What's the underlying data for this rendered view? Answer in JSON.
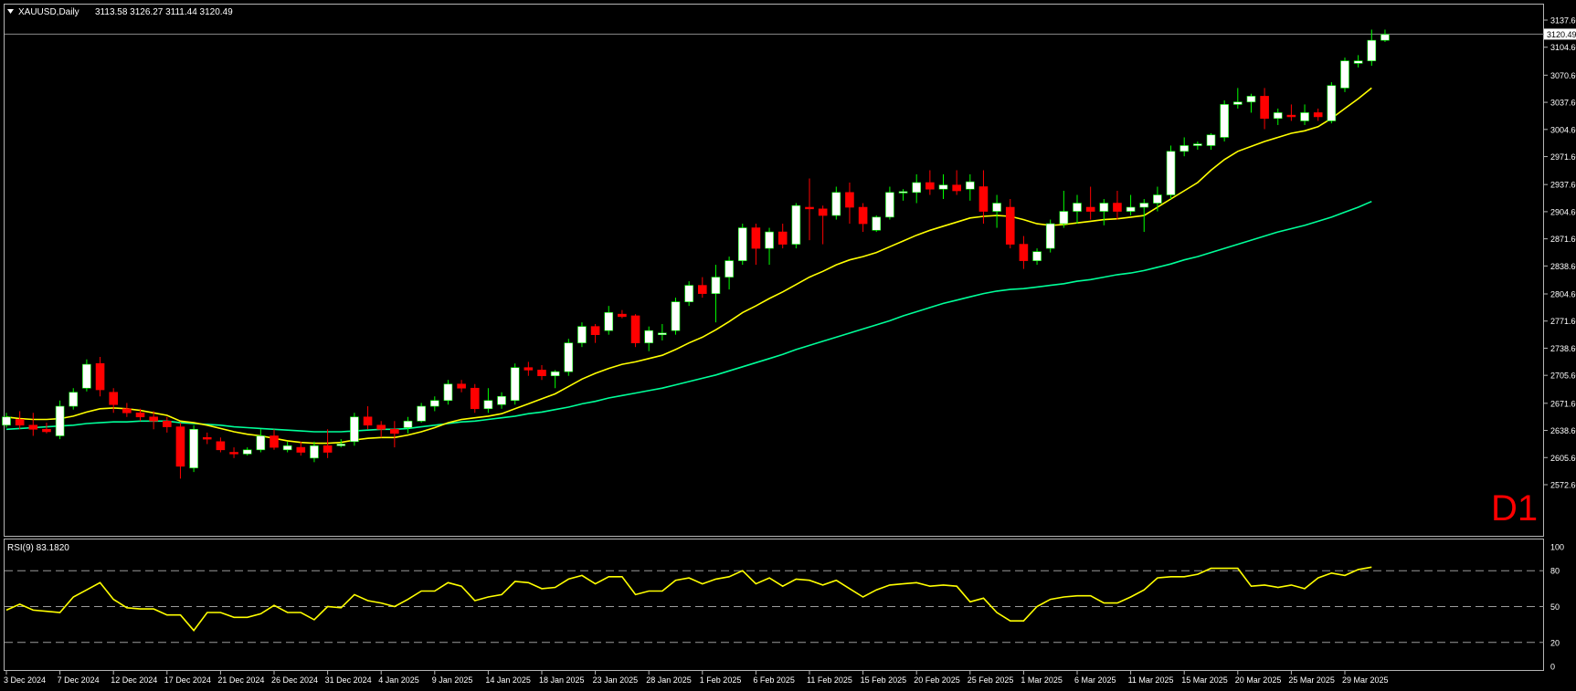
{
  "header": {
    "symbol": "XAUUSD,Daily",
    "ohlc": "3113.58 3126.27 3111.44 3120.49"
  },
  "watermark": "D1",
  "colors": {
    "background": "#000000",
    "bull_fill": "#ffffff",
    "bear_fill": "#ff0000",
    "wick_up": "#00ff00",
    "wick_down": "#ff0000",
    "ma_fast": "#ffff00",
    "ma_slow": "#00ff99",
    "rsi": "#ffff00",
    "grid_text": "#ffffff",
    "bid_line": "#8a8a8a"
  },
  "chart_data": [
    {
      "type": "candlestick",
      "title": "XAUUSD,Daily",
      "price_ticks": [
        "3137.60",
        "3104.60",
        "3070.60",
        "3037.60",
        "3004.60",
        "2971.60",
        "2937.60",
        "2904.60",
        "2871.60",
        "2838.60",
        "2804.60",
        "2771.60",
        "2738.60",
        "2705.60",
        "2671.60",
        "2638.60",
        "2605.60",
        "2572.60"
      ],
      "ylim": [
        2572.6,
        3137.6
      ],
      "current_price_label": "3120.49",
      "current_price": 3120.49,
      "date_labels": [
        "3 Dec 2024",
        "7 Dec 2024",
        "12 Dec 2024",
        "17 Dec 2024",
        "21 Dec 2024",
        "26 Dec 2024",
        "31 Dec 2024",
        "4 Jan 2025",
        "9 Jan 2025",
        "14 Jan 2025",
        "18 Jan 2025",
        "23 Jan 2025",
        "28 Jan 2025",
        "1 Feb 2025",
        "6 Feb 2025",
        "11 Feb 2025",
        "15 Feb 2025",
        "20 Feb 2025",
        "25 Feb 2025",
        "1 Mar 2025",
        "6 Mar 2025",
        "11 Mar 2025",
        "15 Mar 2025",
        "20 Mar 2025",
        "25 Mar 2025",
        "29 Mar 2025"
      ],
      "date_label_bar_index": [
        0,
        4,
        8,
        12,
        16,
        20,
        24,
        28,
        32,
        36,
        40,
        44,
        48,
        52,
        56,
        60,
        64,
        68,
        72,
        76,
        80,
        84,
        88,
        92,
        96,
        100
      ],
      "candles": [
        [
          2645,
          2660,
          2642,
          2655
        ],
        [
          2652,
          2662,
          2640,
          2645
        ],
        [
          2645,
          2660,
          2632,
          2640
        ],
        [
          2640,
          2648,
          2635,
          2637
        ],
        [
          2632,
          2675,
          2628,
          2668
        ],
        [
          2668,
          2690,
          2664,
          2685
        ],
        [
          2690,
          2725,
          2686,
          2719
        ],
        [
          2720,
          2728,
          2680,
          2688
        ],
        [
          2685,
          2690,
          2660,
          2670
        ],
        [
          2665,
          2672,
          2655,
          2660
        ],
        [
          2660,
          2665,
          2650,
          2655
        ],
        [
          2655,
          2662,
          2640,
          2650
        ],
        [
          2650,
          2655,
          2636,
          2643
        ],
        [
          2643,
          2648,
          2580,
          2595
        ],
        [
          2593,
          2645,
          2588,
          2640
        ],
        [
          2630,
          2636,
          2622,
          2628
        ],
        [
          2625,
          2630,
          2612,
          2615
        ],
        [
          2612,
          2618,
          2605,
          2610
        ],
        [
          2610,
          2618,
          2608,
          2615
        ],
        [
          2615,
          2640,
          2612,
          2632
        ],
        [
          2632,
          2640,
          2615,
          2618
        ],
        [
          2615,
          2625,
          2612,
          2620
        ],
        [
          2618,
          2625,
          2608,
          2612
        ],
        [
          2605,
          2625,
          2600,
          2620
        ],
        [
          2620,
          2640,
          2605,
          2612
        ],
        [
          2620,
          2628,
          2618,
          2622
        ],
        [
          2625,
          2660,
          2620,
          2655
        ],
        [
          2655,
          2668,
          2640,
          2645
        ],
        [
          2645,
          2650,
          2630,
          2640
        ],
        [
          2640,
          2650,
          2618,
          2635
        ],
        [
          2642,
          2655,
          2635,
          2650
        ],
        [
          2650,
          2672,
          2648,
          2668
        ],
        [
          2668,
          2680,
          2662,
          2675
        ],
        [
          2675,
          2700,
          2670,
          2695
        ],
        [
          2695,
          2700,
          2685,
          2690
        ],
        [
          2690,
          2695,
          2660,
          2665
        ],
        [
          2665,
          2690,
          2660,
          2675
        ],
        [
          2670,
          2685,
          2665,
          2680
        ],
        [
          2675,
          2720,
          2670,
          2715
        ],
        [
          2715,
          2722,
          2705,
          2712
        ],
        [
          2712,
          2718,
          2700,
          2705
        ],
        [
          2705,
          2712,
          2690,
          2710
        ],
        [
          2710,
          2750,
          2705,
          2745
        ],
        [
          2745,
          2770,
          2740,
          2765
        ],
        [
          2765,
          2768,
          2745,
          2755
        ],
        [
          2760,
          2790,
          2755,
          2782
        ],
        [
          2780,
          2785,
          2775,
          2777
        ],
        [
          2778,
          2780,
          2740,
          2745
        ],
        [
          2745,
          2765,
          2735,
          2760
        ],
        [
          2755,
          2768,
          2748,
          2757
        ],
        [
          2760,
          2800,
          2755,
          2795
        ],
        [
          2795,
          2820,
          2790,
          2815
        ],
        [
          2815,
          2825,
          2800,
          2805
        ],
        [
          2805,
          2840,
          2770,
          2825
        ],
        [
          2825,
          2850,
          2810,
          2845
        ],
        [
          2845,
          2890,
          2840,
          2885
        ],
        [
          2885,
          2890,
          2840,
          2860
        ],
        [
          2860,
          2885,
          2840,
          2880
        ],
        [
          2880,
          2890,
          2860,
          2865
        ],
        [
          2865,
          2915,
          2860,
          2912
        ],
        [
          2910,
          2945,
          2870,
          2908
        ],
        [
          2908,
          2912,
          2865,
          2900
        ],
        [
          2900,
          2935,
          2895,
          2928
        ],
        [
          2928,
          2940,
          2890,
          2910
        ],
        [
          2910,
          2915,
          2880,
          2890
        ],
        [
          2882,
          2900,
          2880,
          2898
        ],
        [
          2898,
          2935,
          2895,
          2928
        ],
        [
          2928,
          2932,
          2918,
          2929
        ],
        [
          2928,
          2950,
          2915,
          2940
        ],
        [
          2940,
          2955,
          2925,
          2932
        ],
        [
          2932,
          2950,
          2920,
          2937
        ],
        [
          2937,
          2955,
          2925,
          2930
        ],
        [
          2932,
          2950,
          2918,
          2941
        ],
        [
          2935,
          2955,
          2890,
          2905
        ],
        [
          2905,
          2925,
          2885,
          2915
        ],
        [
          2910,
          2920,
          2860,
          2865
        ],
        [
          2865,
          2875,
          2835,
          2845
        ],
        [
          2845,
          2860,
          2840,
          2856
        ],
        [
          2860,
          2895,
          2855,
          2890
        ],
        [
          2890,
          2930,
          2885,
          2905
        ],
        [
          2905,
          2925,
          2890,
          2915
        ],
        [
          2910,
          2935,
          2895,
          2905
        ],
        [
          2905,
          2920,
          2888,
          2915
        ],
        [
          2915,
          2930,
          2895,
          2905
        ],
        [
          2905,
          2925,
          2900,
          2910
        ],
        [
          2910,
          2920,
          2880,
          2915
        ],
        [
          2915,
          2935,
          2905,
          2925
        ],
        [
          2925,
          2985,
          2920,
          2978
        ],
        [
          2978,
          2995,
          2972,
          2985
        ],
        [
          2985,
          2990,
          2980,
          2987
        ],
        [
          2985,
          3000,
          2980,
          2998
        ],
        [
          2995,
          3040,
          2990,
          3035
        ],
        [
          3035,
          3055,
          3030,
          3038
        ],
        [
          3038,
          3048,
          3025,
          3045
        ],
        [
          3045,
          3055,
          3005,
          3018
        ],
        [
          3018,
          3030,
          3010,
          3025
        ],
        [
          3022,
          3035,
          3015,
          3020
        ],
        [
          3015,
          3035,
          3010,
          3025
        ],
        [
          3025,
          3030,
          3015,
          3020
        ],
        [
          3015,
          3062,
          3012,
          3058
        ],
        [
          3055,
          3092,
          3050,
          3088
        ],
        [
          3085,
          3095,
          3080,
          3088
        ],
        [
          3088,
          3126,
          3082,
          3113
        ],
        [
          3113,
          3126,
          3111,
          3120
        ]
      ],
      "ma_fast": [
        2655,
        2653,
        2652,
        2652,
        2653,
        2656,
        2661,
        2665,
        2666,
        2665,
        2663,
        2660,
        2657,
        2650,
        2648,
        2645,
        2641,
        2637,
        2634,
        2632,
        2629,
        2626,
        2624,
        2623,
        2623,
        2624,
        2627,
        2629,
        2630,
        2630,
        2633,
        2637,
        2642,
        2648,
        2652,
        2654,
        2656,
        2659,
        2665,
        2671,
        2677,
        2683,
        2692,
        2701,
        2708,
        2714,
        2719,
        2722,
        2726,
        2730,
        2737,
        2745,
        2752,
        2761,
        2771,
        2782,
        2790,
        2799,
        2807,
        2816,
        2825,
        2832,
        2840,
        2846,
        2850,
        2855,
        2862,
        2869,
        2876,
        2882,
        2887,
        2892,
        2897,
        2899,
        2900,
        2899,
        2895,
        2890,
        2888,
        2889,
        2891,
        2893,
        2895,
        2896,
        2898,
        2900,
        2910,
        2920,
        2930,
        2940,
        2955,
        2968,
        2978,
        2984,
        2990,
        2995,
        3000,
        3003,
        3008,
        3018,
        3030,
        3042,
        3055
      ],
      "ma_slow": [
        2640,
        2641,
        2642,
        2643,
        2644,
        2645,
        2647,
        2648,
        2649,
        2649,
        2650,
        2650,
        2650,
        2648,
        2647,
        2646,
        2645,
        2643,
        2642,
        2641,
        2640,
        2639,
        2638,
        2637,
        2637,
        2637,
        2638,
        2639,
        2640,
        2640,
        2641,
        2643,
        2645,
        2647,
        2649,
        2650,
        2652,
        2654,
        2656,
        2659,
        2661,
        2664,
        2667,
        2671,
        2674,
        2678,
        2681,
        2684,
        2687,
        2690,
        2694,
        2698,
        2702,
        2706,
        2711,
        2716,
        2721,
        2726,
        2731,
        2737,
        2742,
        2747,
        2752,
        2757,
        2762,
        2767,
        2772,
        2778,
        2783,
        2788,
        2793,
        2797,
        2801,
        2805,
        2808,
        2810,
        2811,
        2813,
        2815,
        2817,
        2820,
        2822,
        2825,
        2828,
        2830,
        2833,
        2837,
        2841,
        2846,
        2850,
        2855,
        2860,
        2865,
        2870,
        2875,
        2880,
        2884,
        2888,
        2893,
        2898,
        2904,
        2910,
        2917
      ]
    },
    {
      "type": "line",
      "title": "RSI(9) 83.1820",
      "ticks": [
        "100",
        "80",
        "50",
        "20",
        "0"
      ],
      "levels": [
        80,
        50,
        20
      ],
      "ylim": [
        0,
        100
      ],
      "values": [
        47,
        52,
        47,
        46,
        45,
        58,
        64,
        70,
        56,
        49,
        48,
        48,
        43,
        43,
        30,
        45,
        45,
        41,
        41,
        44,
        51,
        45,
        45,
        39,
        50,
        49,
        60,
        55,
        53,
        50,
        56,
        63,
        63,
        70,
        67,
        55,
        58,
        60,
        71,
        70,
        65,
        66,
        73,
        76,
        69,
        75,
        75,
        60,
        63,
        63,
        72,
        74,
        69,
        73,
        75,
        80,
        69,
        74,
        67,
        73,
        72,
        68,
        72,
        65,
        58,
        64,
        68,
        69,
        70,
        67,
        68,
        67,
        54,
        57,
        45,
        38,
        38,
        50,
        56,
        58,
        59,
        59,
        53,
        53,
        58,
        64,
        74,
        75,
        75,
        77,
        82,
        82,
        82,
        67,
        68,
        66,
        68,
        65,
        74,
        78,
        76,
        81,
        83
      ]
    }
  ]
}
